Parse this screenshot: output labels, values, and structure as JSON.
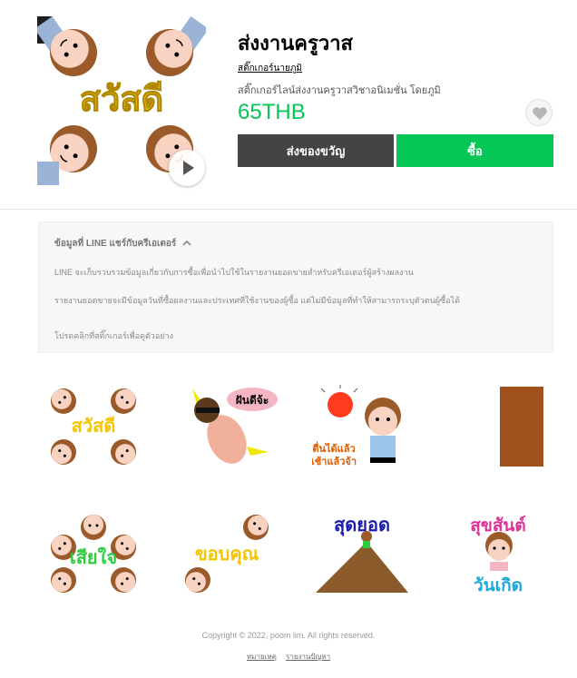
{
  "product": {
    "title": "ส่งงานครูวาส",
    "author": "สติ๊กเกอร์นายภูมิ",
    "description": "สติ๊กเกอร์ไลน์ส่งงานครูวาสวิชาอนิเมชั่น โดยภูมิ",
    "price": "65THB",
    "gift_label": "ส่งของขวัญ",
    "buy_label": "ซื้อ",
    "main_sticker_text": "สวัสดี"
  },
  "info": {
    "heading": "ข้อมูลที่ LINE แชร์กับครีเอเตอร์",
    "line1": "LINE จะเก็บรวบรวมข้อมูลเกี่ยวกับการซื้อเพื่อนำไปใช้ในรายงานยอดขายสำหรับครีเอเตอร์ผู้สร้างผลงาน",
    "line2": "รายงานยอดขายจะมีข้อมูลวันที่ซื้อผลงานและประเทศที่ใช้งานของผู้ซื้อ แต่ไม่มีข้อมูลที่ทำให้สามารถระบุตัวตนผู้ซื้อได้",
    "hint": "โปรดคลิกที่สติ๊กเกอร์เพื่อดูตัวอย่าง"
  },
  "stickers": [
    {
      "caption": "สวัสดี",
      "icon": "greeting-faces"
    },
    {
      "caption": "ฝันดีจ้ะ",
      "icon": "sleeping-boy"
    },
    {
      "caption_line1": "ตื่นได้แล้ว",
      "caption_line2": "เช้าแล้วจ้า",
      "icon": "sun-wakeup"
    },
    {
      "caption": "",
      "icon": "door"
    },
    {
      "caption": "เสียใจ",
      "icon": "sad-faces"
    },
    {
      "caption": "ขอบคุณ",
      "icon": "thank-faces"
    },
    {
      "caption": "สุดยอด",
      "icon": "mountain-top"
    },
    {
      "caption_line1": "สุขสันต์",
      "caption_line2": "วันเกิด",
      "icon": "birthday-cake"
    }
  ],
  "footer": {
    "copyright": "Copyright © 2022, poom lim. All rights reserved.",
    "link1": "หมายเหตุ",
    "link2": "รายงานปัญหา"
  },
  "colors": {
    "accent": "#06c755",
    "gift_button": "#444444",
    "face_skin": "#f9d3c2",
    "hair": "#9b5a2a",
    "caption_yellow": "#f5c400",
    "caption_green": "#2ecc40",
    "caption_navy": "#1a1ab0",
    "caption_pink": "#e0309a",
    "caption_cyan": "#1aa8d8"
  }
}
